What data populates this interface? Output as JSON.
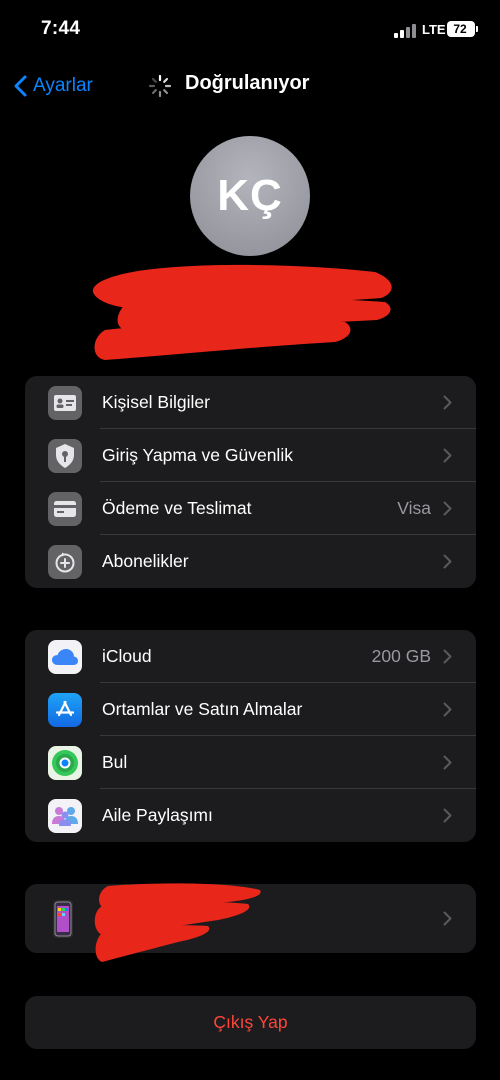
{
  "status_bar": {
    "time": "7:44",
    "network": "LTE",
    "battery": "72"
  },
  "nav": {
    "back_label": "Ayarlar",
    "title": "Doğrulanıyor"
  },
  "profile": {
    "initials": "KÇ"
  },
  "group1": [
    {
      "label": "Kişisel Bilgiler",
      "icon": "id-card-icon"
    },
    {
      "label": "Giriş Yapma ve Güvenlik",
      "icon": "shield-icon"
    },
    {
      "label": "Ödeme ve Teslimat",
      "value": "Visa",
      "icon": "credit-card-icon"
    },
    {
      "label": "Abonelikler",
      "icon": "subscriptions-icon"
    }
  ],
  "group2": [
    {
      "label": "iCloud",
      "value": "200 GB",
      "icon": "icloud-icon"
    },
    {
      "label": "Ortamlar ve Satın Almalar",
      "icon": "app-store-icon"
    },
    {
      "label": "Bul",
      "icon": "find-my-icon"
    },
    {
      "label": "Aile Paylaşımı",
      "icon": "family-icon"
    }
  ],
  "device_row": {
    "icon": "iphone-icon"
  },
  "sign_out": {
    "label": "Çıkış Yap"
  },
  "colors": {
    "accent": "#0a84ff",
    "destructive": "#ff453a",
    "cell_bg": "#1c1c1e",
    "redaction": "#e8261a"
  }
}
